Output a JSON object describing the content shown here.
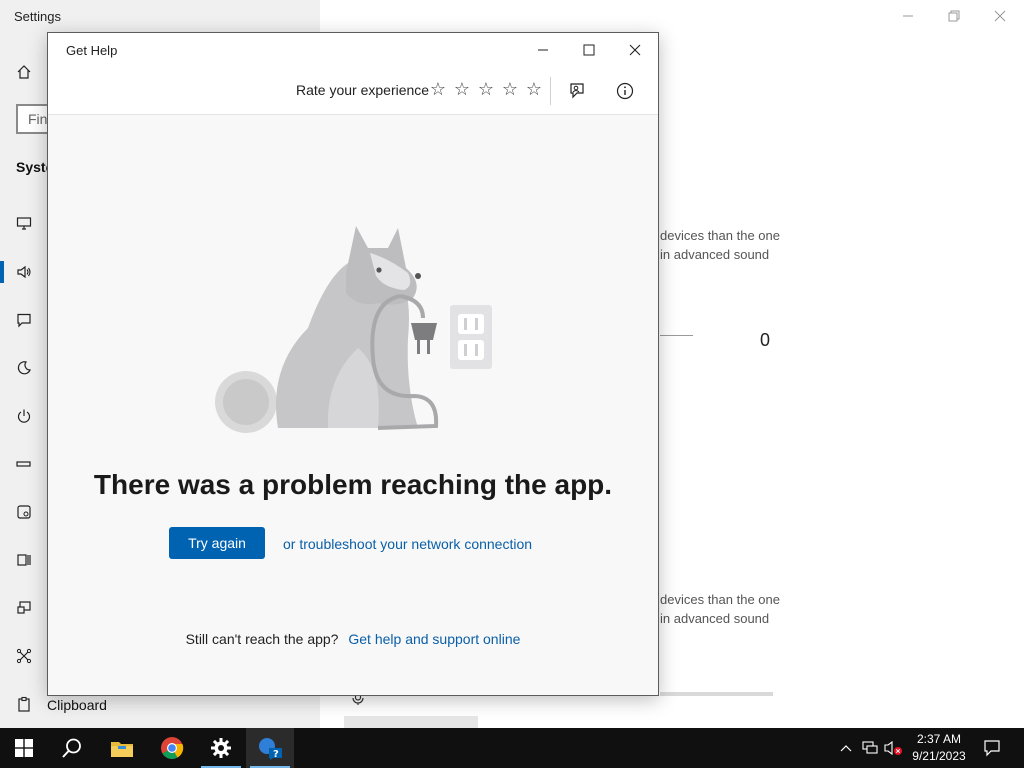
{
  "settings": {
    "title": "Settings",
    "search_placeholder": "Find",
    "section_heading": "Syste",
    "clipboard_label": "Clipboard",
    "bg_text_1_line1": "devices than the one",
    "bg_text_1_line2": "in advanced sound",
    "bg_value": "0",
    "bg_text_2_line1": "devices than the one",
    "bg_text_2_line2": "in advanced sound"
  },
  "get_help": {
    "title": "Get Help",
    "rate_label": "Rate your experience",
    "stars": [
      "☆",
      "☆",
      "☆",
      "☆",
      "☆"
    ],
    "error_heading": "There was a problem reaching the app.",
    "try_again_label": "Try again",
    "troubleshoot_label": "or troubleshoot your network connection",
    "still_text": "Still can't reach the app?",
    "support_link_label": "Get help and support online"
  },
  "taskbar": {
    "time": "2:37 AM",
    "date": "9/21/2023"
  },
  "icons": {
    "sidebar": [
      "home-icon",
      "display-icon",
      "sound-icon",
      "notifications-icon",
      "focus-assist-icon",
      "power-icon",
      "battery-icon",
      "storage-icon",
      "tablet-icon",
      "multitasking-icon",
      "projecting-icon",
      "shared-experiences-icon",
      "clipboard-icon"
    ],
    "taskbar": [
      "windows-start-icon",
      "search-icon",
      "file-explorer-icon",
      "chrome-icon",
      "settings-gear-icon",
      "get-help-icon"
    ]
  },
  "colors": {
    "accent": "#0063b1",
    "link": "#0a5fa8",
    "taskbar": "#101010"
  }
}
